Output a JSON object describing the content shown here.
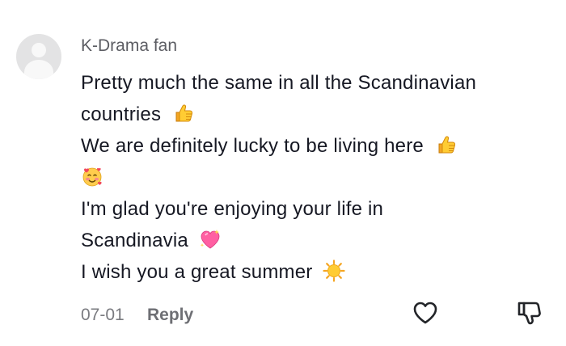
{
  "comment": {
    "username": "K-Drama fan",
    "lines": [
      "Pretty much the same in all the Scandinavian",
      "countries",
      "We are definitely lucky to be living here",
      "",
      "I'm glad you're enjoying your life in",
      "Scandinavia",
      "I wish you a great summer"
    ],
    "emojis": {
      "line2": "thumbs-up",
      "line3": "thumbs-up",
      "line4": "smiling-face-with-hearts",
      "line6": "sparkling-heart",
      "line7": "sun"
    },
    "date": "07-01",
    "reply_label": "Reply",
    "actions": {
      "like_icon": "heart-outline-icon",
      "dislike_icon": "thumbs-down-outline-icon"
    }
  },
  "colors": {
    "username": "#5c5d63",
    "text": "#161823",
    "meta": "#7a7b80",
    "avatar_bg": "#e3e3e4"
  }
}
